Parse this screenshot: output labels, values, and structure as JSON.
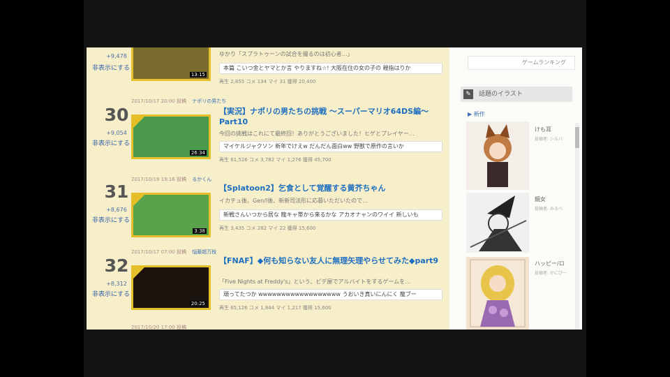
{
  "ranking": {
    "hide_label": "非表示にする",
    "top_partial": {
      "delta": "+9,478",
      "desc": "ゆかり「スプラトゥーンの試合を撮るのは初心者…」",
      "comment": "本篇 こいつ金とヤマとか言 やりますね☆! 大阪在住の女の子の 親指はりか",
      "stats": "再生 2,855 コメ 134 マイ 31 獲得 20,400",
      "duration": "13:15"
    },
    "items": [
      {
        "rank": "30",
        "delta": "+9,054",
        "meta_date": "2017/10/17 20:00 投稿",
        "meta_user": "ナポリの男たち",
        "title": "【実況】ナポリの男たちの挑戦 ～スーパーマリオ64DS編～Part10",
        "desc": "今回の挑戦はこれにて最終回！ありがとうございました！ヒゲとプレイヤー…",
        "comment": "マイケルジャクソン 新年でけえw だんだん面白ww 野獣で原作の言いか",
        "stats": "再生 61,526 コメ 3,782 マイ 1,276 獲得 45,700",
        "duration": "26:34",
        "thumb_bg": "#4b9a4b"
      },
      {
        "rank": "31",
        "delta": "+8,676",
        "meta_date": "2017/10/19 19:16 投稿",
        "meta_user": "るかくん",
        "title": "【Splatoon2】乞食として覚醒する黄芥ちゃん",
        "desc": "イカチュ後、Gen/l後、新新司法形に応募いただいたので…",
        "comment": "新戦さんいつから居な 龍キャ帯から来るかな アカオナャンのワイイ 新しいも",
        "stats": "再生 3,435 コメ 282 マイ 22 獲得 15,600",
        "duration": "3:38",
        "thumb_bg": "#5aa34a"
      },
      {
        "rank": "32",
        "delta": "+8,312",
        "meta_date": "2017/10/17 07:00 投稿",
        "meta_user": "悩藤超万枝",
        "title": "【FNAF】◆何も知らない友人に無理矢理やらせてみた◆part9",
        "desc": "「Five Nights at Freddy's」という、ビデ屋でアルバイトをするゲームを…",
        "comment": "頑ってたつか wwwwwwwwwwwwwwwwww うおいき真いにんにく 龍ブー",
        "stats": "再生 65,126 コメ 1,844 マイ 1,217 獲得 15,600",
        "duration": "20:25",
        "thumb_bg": "#1b140e"
      }
    ],
    "next_meta": "2017/10/20 17:00 投稿"
  },
  "sidebar": {
    "game_ranking": "ゲームランキング",
    "illust_head": "話題のイラスト",
    "new_label": "▶ 新作",
    "illusts": [
      {
        "title": "けも耳",
        "sub": "投稿者: シルバ"
      },
      {
        "title": "鏡女",
        "sub": "投稿者: みるべ"
      },
      {
        "title": "ハッピー/ロ",
        "sub": "投稿者: かにぴー"
      }
    ]
  },
  "colors": {
    "ranking_bg": "#f7efc9",
    "title_blue": "#1d6ec0",
    "thumb_border": "#e5bf2a"
  }
}
